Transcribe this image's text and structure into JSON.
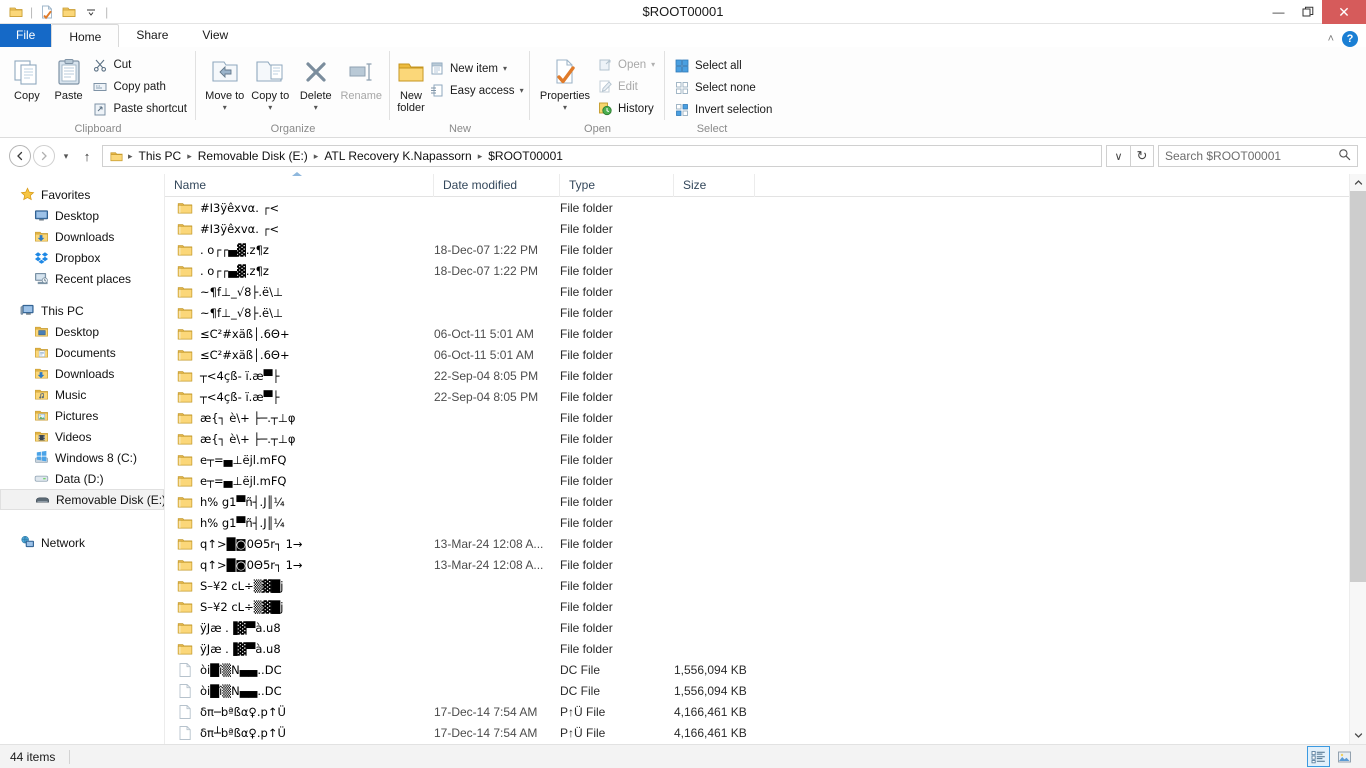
{
  "window": {
    "title": "$ROOT00001",
    "minimize_label": "—",
    "restore_label": "❐",
    "close_label": "✕"
  },
  "quick_access": {
    "items": [
      {
        "name": "properties-icon",
        "label": ""
      },
      {
        "name": "new-folder-icon",
        "label": ""
      },
      {
        "name": "customize-qat-icon",
        "label": ""
      }
    ]
  },
  "tabs": {
    "file": "File",
    "items": [
      {
        "label": "Home",
        "active": true
      },
      {
        "label": "Share",
        "active": false
      },
      {
        "label": "View",
        "active": false
      }
    ],
    "help_label": "?",
    "collapse_label": "˄"
  },
  "ribbon": {
    "groups": [
      {
        "name": "Clipboard",
        "big": [
          {
            "label": "Copy",
            "icon": "copy-icon",
            "disabled": false
          },
          {
            "label": "Paste",
            "icon": "paste-icon",
            "disabled": false
          }
        ],
        "small": [
          {
            "label": "Cut",
            "icon": "scissors-icon",
            "disabled": false
          },
          {
            "label": "Copy path",
            "icon": "copy-path-icon",
            "disabled": false
          },
          {
            "label": "Paste shortcut",
            "icon": "paste-shortcut-icon",
            "disabled": false
          }
        ]
      },
      {
        "name": "Organize",
        "big": [
          {
            "label": "Move to",
            "icon": "move-to-icon",
            "disabled": false,
            "caret": true
          },
          {
            "label": "Copy to",
            "icon": "copy-to-icon",
            "disabled": false,
            "caret": true
          },
          {
            "label": "Delete",
            "icon": "delete-icon",
            "disabled": false,
            "caret": true
          },
          {
            "label": "Rename",
            "icon": "rename-icon",
            "disabled": true
          }
        ],
        "small": []
      },
      {
        "name": "New",
        "big": [
          {
            "label": "New folder",
            "icon": "new-folder-icon",
            "disabled": false
          }
        ],
        "small": [
          {
            "label": "New item",
            "icon": "new-item-icon",
            "disabled": false,
            "caret": true
          },
          {
            "label": "Easy access",
            "icon": "easy-access-icon",
            "disabled": false,
            "caret": true
          }
        ]
      },
      {
        "name": "Open",
        "big": [
          {
            "label": "Properties",
            "icon": "properties-icon",
            "disabled": false,
            "caret": true
          }
        ],
        "small": [
          {
            "label": "Open",
            "icon": "open-icon",
            "disabled": true,
            "caret": true
          },
          {
            "label": "Edit",
            "icon": "edit-icon",
            "disabled": true
          },
          {
            "label": "History",
            "icon": "history-icon",
            "disabled": false
          }
        ]
      },
      {
        "name": "Select",
        "big": [],
        "small": [
          {
            "label": "Select all",
            "icon": "select-all-icon",
            "disabled": false
          },
          {
            "label": "Select none",
            "icon": "select-none-icon",
            "disabled": false
          },
          {
            "label": "Invert selection",
            "icon": "invert-selection-icon",
            "disabled": false
          }
        ]
      }
    ]
  },
  "address": {
    "back_label": "←",
    "forward_label": "→",
    "recent_label": "▾",
    "up_label": "↑",
    "breadcrumbs": [
      "This PC",
      "Removable Disk (E:)",
      "ATL Recovery K.Napassorn",
      "$ROOT00001"
    ],
    "dropdown_label": "∨",
    "refresh_label": "↻",
    "search_placeholder": "Search $ROOT00001",
    "search_value": "",
    "search_icon": "magnifier-icon"
  },
  "sidebar": {
    "sections": [
      {
        "name": "Favorites",
        "icon": "star-icon",
        "items": [
          {
            "label": "Desktop",
            "icon": "desktop-icon"
          },
          {
            "label": "Downloads",
            "icon": "downloads-folder-icon"
          },
          {
            "label": "Dropbox",
            "icon": "dropbox-icon"
          },
          {
            "label": "Recent places",
            "icon": "recent-places-icon"
          }
        ]
      },
      {
        "name": "This PC",
        "icon": "computer-icon",
        "items": [
          {
            "label": "Desktop",
            "icon": "desktop-folder-icon"
          },
          {
            "label": "Documents",
            "icon": "documents-folder-icon"
          },
          {
            "label": "Downloads",
            "icon": "downloads-folder-icon"
          },
          {
            "label": "Music",
            "icon": "music-folder-icon"
          },
          {
            "label": "Pictures",
            "icon": "pictures-folder-icon"
          },
          {
            "label": "Videos",
            "icon": "videos-folder-icon"
          },
          {
            "label": "Windows 8 (C:)",
            "icon": "windows-drive-icon"
          },
          {
            "label": "Data (D:)",
            "icon": "drive-icon"
          },
          {
            "label": "Removable Disk (E:)",
            "icon": "removable-drive-icon",
            "selected": true
          }
        ]
      },
      {
        "name": "Network",
        "icon": "network-icon",
        "items": []
      }
    ]
  },
  "filelist": {
    "columns": [
      {
        "label": "Name",
        "sorted": "asc"
      },
      {
        "label": "Date modified",
        "sorted": ""
      },
      {
        "label": "Type",
        "sorted": ""
      },
      {
        "label": "Size",
        "sorted": ""
      }
    ],
    "rows": [
      {
        "name": "#I3ÿêxvα. ┌<",
        "date": "",
        "type": "File folder",
        "size": "",
        "icon": "folder-icon"
      },
      {
        "name": "#I3ÿêxvα. ┌<",
        "date": "",
        "type": "File folder",
        "size": "",
        "icon": "folder-icon"
      },
      {
        "name": ". o┌┌▄▓.z¶z",
        "date": "18-Dec-07 1:22 PM",
        "type": "File folder",
        "size": "",
        "icon": "folder-icon"
      },
      {
        "name": ". o┌┌▄▓.z¶z",
        "date": "18-Dec-07 1:22 PM",
        "type": "File folder",
        "size": "",
        "icon": "folder-icon"
      },
      {
        "name": "~¶f⊥_√8├.ë\\⊥",
        "date": "",
        "type": "File folder",
        "size": "",
        "icon": "folder-icon"
      },
      {
        "name": "~¶f⊥_√8├.ë\\⊥",
        "date": "",
        "type": "File folder",
        "size": "",
        "icon": "folder-icon"
      },
      {
        "name": "≤C²#xäß│.6Θ+",
        "date": "06-Oct-11 5:01 AM",
        "type": "File folder",
        "size": "",
        "icon": "folder-icon"
      },
      {
        "name": "≤C²#xäß│.6Θ+",
        "date": "06-Oct-11 5:01 AM",
        "type": "File folder",
        "size": "",
        "icon": "folder-icon"
      },
      {
        "name": "┬<4çß- ï.æ▀├",
        "date": "22-Sep-04 8:05 PM",
        "type": "File folder",
        "size": "",
        "icon": "folder-icon"
      },
      {
        "name": "┬<4çß- ï.æ▀├",
        "date": "22-Sep-04 8:05 PM",
        "type": "File folder",
        "size": "",
        "icon": "folder-icon"
      },
      {
        "name": "æ{┐ è\\+ ├─.┬⊥φ",
        "date": "",
        "type": "File folder",
        "size": "",
        "icon": "folder-icon"
      },
      {
        "name": "æ{┐ è\\+ ├─.┬⊥φ",
        "date": "",
        "type": "File folder",
        "size": "",
        "icon": "folder-icon"
      },
      {
        "name": "e┬=▄⊥ëjl.mFQ",
        "date": "",
        "type": "File folder",
        "size": "",
        "icon": "folder-icon"
      },
      {
        "name": "e┬=▄⊥ëjl.mFQ",
        "date": "",
        "type": "File folder",
        "size": "",
        "icon": "folder-icon"
      },
      {
        "name": "h% g1▀ñ┤.J║¼",
        "date": "",
        "type": "File folder",
        "size": "",
        "icon": "folder-icon"
      },
      {
        "name": "h% g1▀ñ┤.J║¼",
        "date": "",
        "type": "File folder",
        "size": "",
        "icon": "folder-icon"
      },
      {
        "name": "q↑>█◙0Θ5r┐ 1→",
        "date": "13-Mar-24 12:08 A...",
        "type": "File folder",
        "size": "",
        "icon": "folder-icon"
      },
      {
        "name": "q↑>█◙0Θ5r┐ 1→",
        "date": "13-Mar-24 12:08 A...",
        "type": "File folder",
        "size": "",
        "icon": "folder-icon"
      },
      {
        "name": "S–¥2 cL÷▒▓█j",
        "date": "",
        "type": "File folder",
        "size": "",
        "icon": "folder-icon"
      },
      {
        "name": "S–¥2 cL÷▒▓█j",
        "date": "",
        "type": "File folder",
        "size": "",
        "icon": "folder-icon"
      },
      {
        "name": "ÿJæ .▐▓▀à.u8",
        "date": "",
        "type": "File folder",
        "size": "",
        "icon": "folder-icon"
      },
      {
        "name": "ÿJæ .▐▓▀à.u8",
        "date": "",
        "type": "File folder",
        "size": "",
        "icon": "folder-icon"
      },
      {
        "name": "òi█î▒N▄▄..DC",
        "date": "",
        "type": "DC File",
        "size": "1,556,094 KB",
        "icon": "file-icon"
      },
      {
        "name": "òi█î▒N▄▄..DC",
        "date": "",
        "type": "DC File",
        "size": "1,556,094 KB",
        "icon": "file-icon"
      },
      {
        "name": "δπ─bªßα♀.p↑Ü",
        "date": "17-Dec-14 7:54 AM",
        "type": "P↑Ü File",
        "size": "4,166,461 KB",
        "icon": "file-icon"
      },
      {
        "name": "δπ┴bªßα♀.p↑Ü",
        "date": "17-Dec-14 7:54 AM",
        "type": "P↑Ü File",
        "size": "4,166,461 KB",
        "icon": "file-icon"
      }
    ]
  },
  "statusbar": {
    "item_count": "44 items",
    "views": [
      {
        "name": "details-view-button",
        "active": true
      },
      {
        "name": "large-icons-view-button",
        "active": false
      }
    ]
  },
  "colors": {
    "accent": "#1569c7",
    "close_button": "#d65b5b",
    "folder_yellow": "#fbd779",
    "column_header_text": "#33475b",
    "scrollbar_thumb": "#cdcdcd"
  }
}
